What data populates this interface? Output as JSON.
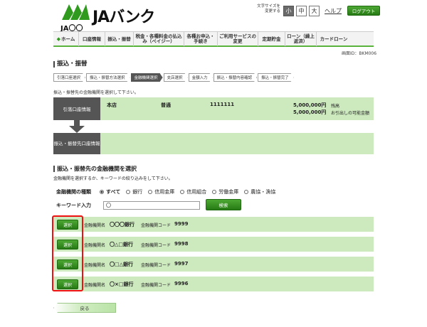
{
  "header": {
    "logo_text": "JAバンク",
    "logo_sub": "JA〇〇",
    "font_size_label": "文字サイズを変更する",
    "font_sizes": [
      "小",
      "中",
      "大"
    ],
    "help": "ヘルプ",
    "logout": "ログアウト"
  },
  "nav": [
    "ホーム",
    "口座情報",
    "振込・振替",
    "税金・各種料金の払込み（ペイジー）",
    "各種お申込・手続き",
    "ご利用サービスの変更",
    "定期貯金",
    "ローン（繰上返済）",
    "カードローン"
  ],
  "screen_id": "画面ID：BKM006",
  "page_title": "振込・振替",
  "steps": [
    "引落口座選択",
    "振込・振替方法選択",
    "金融機関選択",
    "支店選択",
    "金額入力",
    "振込・振替内容確認",
    "振込・振替完了"
  ],
  "instruction": "振込・振替先の金融機関を選択して下さい。",
  "account": {
    "label": "引落口座情報",
    "branch": "本店",
    "type": "普通",
    "number": "1111111",
    "balance": "5,000,000円",
    "balance_label": "残高",
    "withdrawable": "5,000,000円",
    "withdrawable_label": "お引出しの可能金額"
  },
  "dest_label": "振込・振替先口座情報",
  "select_section": {
    "title": "振込・振替先の金融機関を選択",
    "desc": "金融機関を選択するか、キーワードの絞り込みをして下さい。",
    "type_label": "金融機関の種類",
    "types": [
      "すべて",
      "銀行",
      "信用金庫",
      "信用組合",
      "労働金庫",
      "農協・漁協"
    ],
    "keyword_label": "キーワード入力",
    "keyword_value": "〇",
    "search_button": "検索"
  },
  "banks": [
    {
      "select": "選択",
      "name_label": "金融機関名",
      "name": "〇〇〇銀行",
      "code_label": "金融機関コード",
      "code": "9999"
    },
    {
      "select": "選択",
      "name_label": "金融機関名",
      "name": "〇△□銀行",
      "code_label": "金融機関コード",
      "code": "9998"
    },
    {
      "select": "選択",
      "name_label": "金融機関名",
      "name": "〇□△銀行",
      "code_label": "金融機関コード",
      "code": "9997"
    },
    {
      "select": "選択",
      "name_label": "金融機関名",
      "name": "〇×□銀行",
      "code_label": "金融機関コード",
      "code": "9996"
    }
  ],
  "back_button": "戻る",
  "colors": {
    "accent_green": "#3a9a22",
    "row_green": "#cdeabf",
    "label_gray": "#555555",
    "highlight_red": "#e11111"
  },
  "icons": {
    "home": "home-icon",
    "arrow": "down-arrow-icon"
  }
}
